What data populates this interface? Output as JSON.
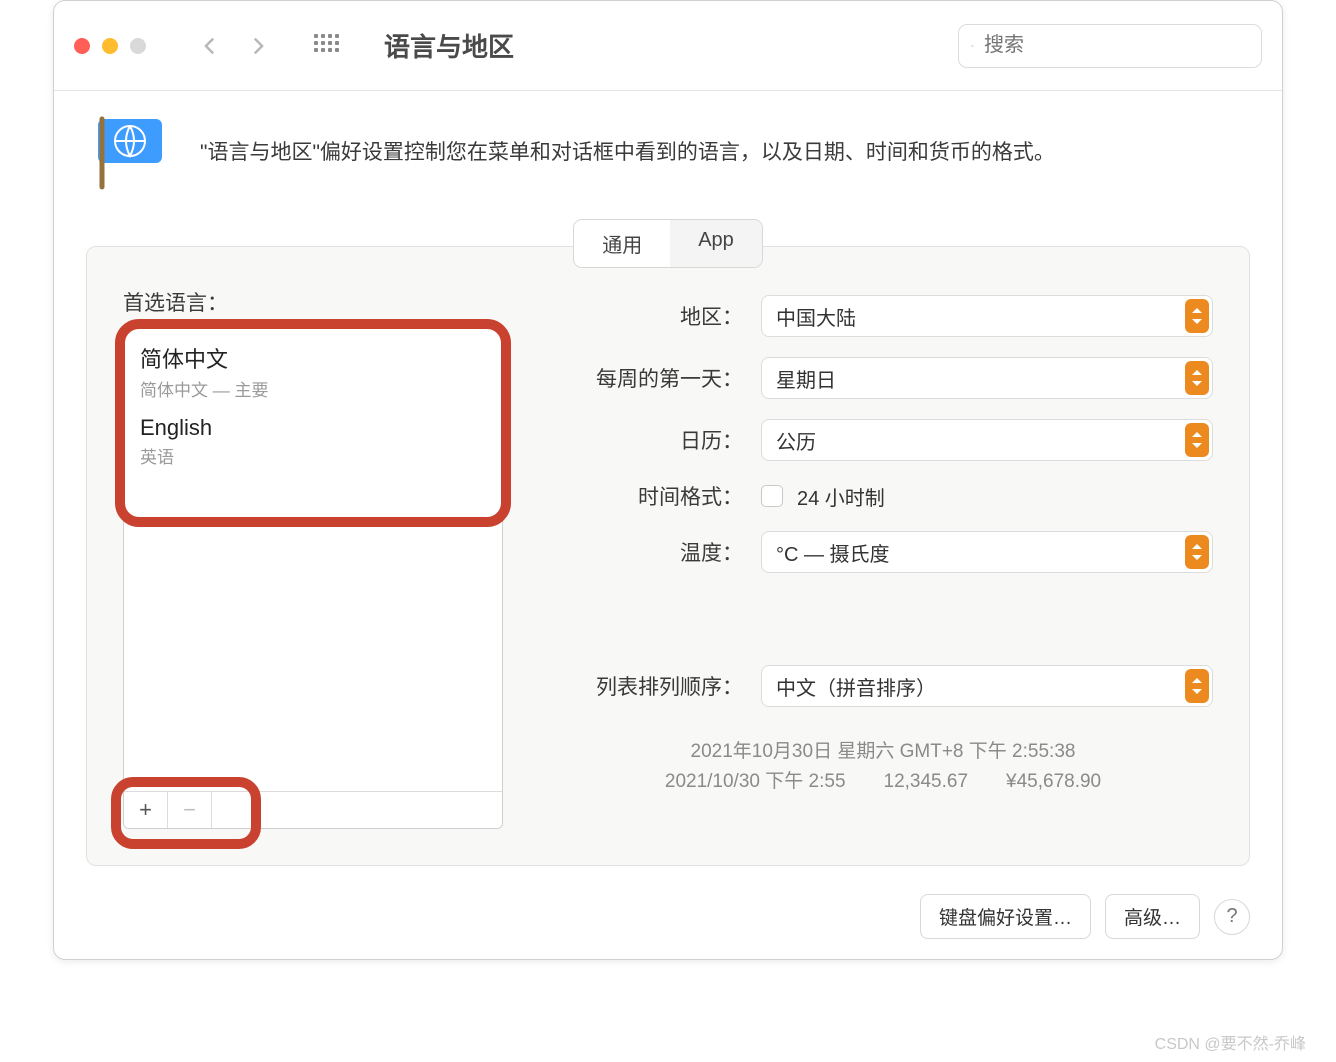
{
  "toolbar": {
    "title": "语言与地区",
    "search_placeholder": "搜索"
  },
  "header": {
    "description": "\"语言与地区\"偏好设置控制您在菜单和对话框中看到的语言，以及日期、时间和货币的格式。"
  },
  "tabs": [
    "通用",
    "App"
  ],
  "left": {
    "label": "首选语言：",
    "languages": [
      {
        "name": "简体中文",
        "sub": "简体中文 — 主要"
      },
      {
        "name": "English",
        "sub": "英语"
      }
    ]
  },
  "right": {
    "region": {
      "label": "地区：",
      "value": "中国大陆"
    },
    "firstday": {
      "label": "每周的第一天：",
      "value": "星期日"
    },
    "calendar": {
      "label": "日历：",
      "value": "公历"
    },
    "time_format": {
      "label": "时间格式：",
      "option": "24 小时制"
    },
    "temperature": {
      "label": "温度：",
      "value": "°C — 摄氏度"
    },
    "sort_order": {
      "label": "列表排列顺序：",
      "value": "中文（拼音排序）"
    }
  },
  "preview": {
    "line1": "2021年10月30日 星期六 GMT+8 下午 2:55:38",
    "line2": "2021/10/30 下午 2:55　　12,345.67　　¥45,678.90"
  },
  "footer": {
    "keyboard": "键盘偏好设置…",
    "advanced": "高级…"
  },
  "watermark": "CSDN @要不然-乔峰"
}
